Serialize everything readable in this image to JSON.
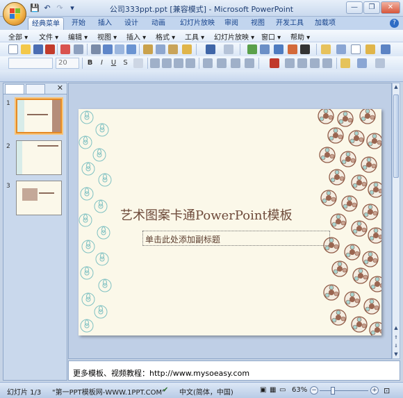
{
  "window": {
    "title": "公司333ppt.ppt [兼容模式] - Microsoft PowerPoint",
    "colors": {
      "titlebar": "#c9d9ee",
      "accent": "#15428b",
      "selected_thumb": "#e58a25"
    }
  },
  "ribbon_tabs": [
    "经典菜单",
    "开始",
    "插入",
    "设计",
    "动画",
    "幻灯片放映",
    "审阅",
    "视图",
    "开发工具",
    "加载项"
  ],
  "active_tab": "经典菜单",
  "menu": [
    "全部 ▾",
    "文件 ▾",
    "编辑 ▾",
    "视图 ▾",
    "插入 ▾",
    "格式 ▾",
    "工具 ▾",
    "幻灯片放映 ▾",
    "窗口 ▾",
    "帮助 ▾"
  ],
  "format_bar": {
    "font_size": "20",
    "bold": "B",
    "italic": "I",
    "underline": "U",
    "strike": "S"
  },
  "slides": [
    {
      "number": "1",
      "selected": true
    },
    {
      "number": "2",
      "selected": false
    },
    {
      "number": "3",
      "selected": false
    }
  ],
  "slide": {
    "title": "艺术图案卡通PowerPoint模板",
    "subtitle_placeholder": "单击此处添加副标题"
  },
  "notes": {
    "text": "更多模板、视频教程：http://www.mysoeasy.com"
  },
  "status": {
    "slide_count": "幻灯片 1/3",
    "theme": "\"第一PPT模板网-WWW.1PPT.COM\"",
    "language": "中文(简体，中国)",
    "zoom": "63%"
  }
}
